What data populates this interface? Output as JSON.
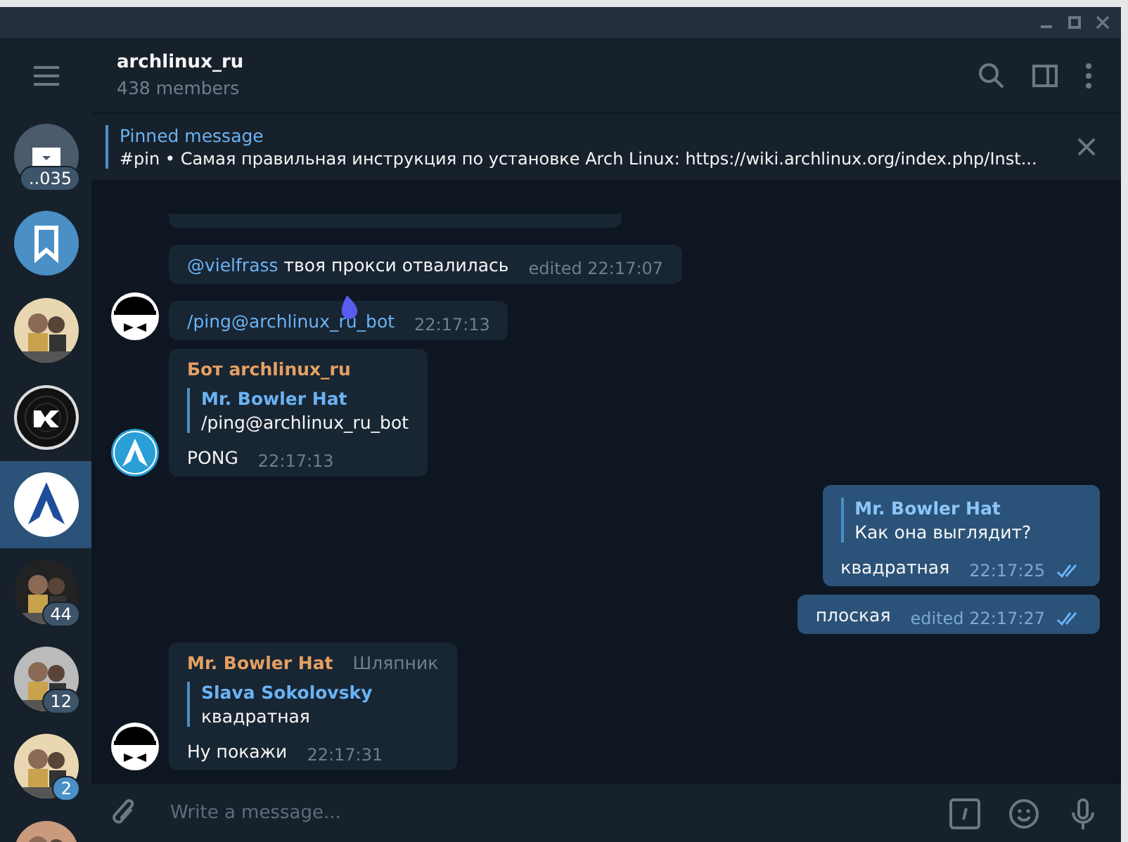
{
  "sidebar": {
    "chats": [
      {
        "kind": "archive",
        "badge": "..035",
        "selected": false
      },
      {
        "kind": "saved",
        "selected": false
      },
      {
        "kind": "picture",
        "selected": false
      },
      {
        "kind": "vinyl",
        "selected": false
      },
      {
        "kind": "arch",
        "selected": true
      },
      {
        "kind": "picture",
        "badge": "44",
        "selected": false
      },
      {
        "kind": "picture",
        "badge": "12",
        "selected": false
      },
      {
        "kind": "picture",
        "badge": "2",
        "badge_active": true,
        "selected": false
      },
      {
        "kind": "picture",
        "selected": false
      }
    ]
  },
  "header": {
    "title": "archlinux_ru",
    "subtitle": "438 members"
  },
  "pinned": {
    "label": "Pinned message",
    "text": "#pin • Самая правильная инструкция по установке Arch Linux: https://wiki.archlinux.org/index.php/Inst..."
  },
  "messages": [
    {
      "kind": "incoming",
      "mention": "@vielfrass",
      "text": "твоя прокси отвалилась",
      "command": false,
      "time": "edited 22:17:07"
    },
    {
      "kind": "incoming",
      "avatar": {
        "kind": "hat"
      },
      "text": "/ping@archlinux_ru_bot",
      "command": true,
      "time": "22:17:13"
    },
    {
      "kind": "incoming",
      "avatar": {
        "kind": "arch"
      },
      "sender": "Бот archlinux_ru",
      "reply": {
        "name": "Mr. Bowler Hat",
        "text": "/ping@archlinux_ru_bot"
      },
      "text": "PONG",
      "command": false,
      "time": "22:17:13"
    },
    {
      "kind": "outgoing",
      "reply": {
        "name": "Mr. Bowler Hat",
        "text": "Как она выглядит?"
      },
      "text": "квадратная",
      "command": false,
      "time": "22:17:25",
      "read": true
    },
    {
      "kind": "outgoing",
      "text": "плоская",
      "command": false,
      "time": "edited 22:17:27",
      "read": true
    },
    {
      "kind": "incoming",
      "avatar": {
        "kind": "hat"
      },
      "sender": "Mr. Bowler Hat",
      "title": "Шляпник",
      "reply": {
        "name": "Slava Sokolovsky",
        "text": "квадратная"
      },
      "text": "Ну покажи",
      "command": false,
      "time": "22:17:31"
    }
  ],
  "composer": {
    "placeholder": "Write a message..."
  }
}
